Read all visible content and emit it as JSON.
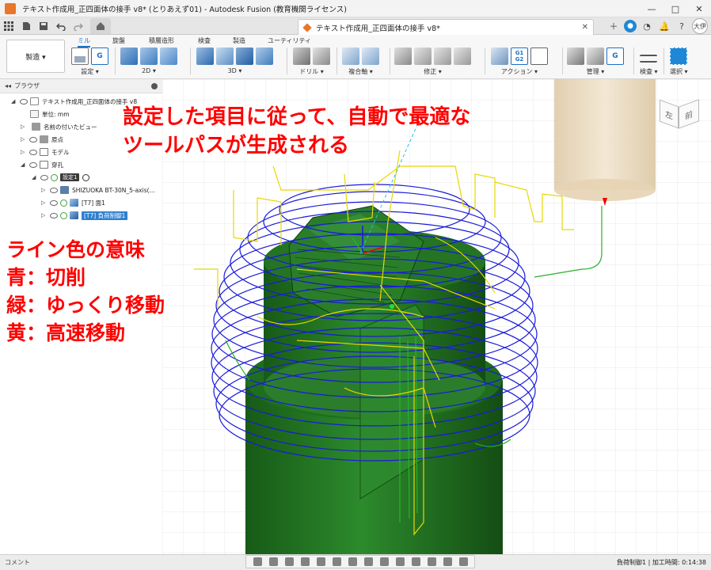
{
  "window": {
    "title": "テキスト作成用_正四面体の接手 v8* (とりあえず01) - Autodesk Fusion (教育機関ライセンス)",
    "buttons": [
      "—",
      "□",
      "✕"
    ]
  },
  "tabbar": {
    "doc_title": "テキスト作成用_正四面体の接手 v8*",
    "close": "✕",
    "avatar": "大伊"
  },
  "ribbon": {
    "workspace": "製造 ▾",
    "tabs": [
      "ミル",
      "旋盤",
      "積層造形",
      "検査",
      "製造",
      "ユーティリティ"
    ],
    "groups": [
      "設定 ▾",
      "2D ▾",
      "3D ▾",
      "ドリル ▾",
      "複合軸 ▾",
      "修正 ▾",
      "アクション ▾",
      "管理 ▾",
      "検査 ▾",
      "選択 ▾"
    ]
  },
  "browser": {
    "title": "ブラウザ",
    "items": [
      {
        "label": "テキスト作成用_正四面体の接手 v8"
      },
      {
        "label": "単位: mm"
      },
      {
        "label": "名前の付いたビュー"
      },
      {
        "label": "原点"
      },
      {
        "label": "モデル"
      },
      {
        "label": "穿孔"
      },
      {
        "label": "設定1"
      },
      {
        "label": "SHIZUOKA BT-30N_5-axis(..."
      },
      {
        "label": "[T7] 面1"
      },
      {
        "label": "[T7] 負荷制御1"
      }
    ]
  },
  "viewcube": {
    "left": "左",
    "front": "前"
  },
  "annotations": {
    "top_line1": "設定した項目に従って、自動で最適な",
    "top_line2": "ツールパスが生成される",
    "legend_title": "ライン色の意味",
    "legend_blue": "青：切削",
    "legend_green": "緑：ゆっくり移動",
    "legend_yellow": "黄：高速移動"
  },
  "statusbar": {
    "comment_label": "コメント",
    "status": "負荷制御1 | 加工時間: 0:14:38"
  },
  "colors": {
    "cutting": "#1a1adc",
    "slow_move": "#28b028",
    "rapid_move": "#f0e000",
    "stock": "#e9d9bd",
    "part": "#1f6b1f",
    "accent": "#1e6fc3",
    "annotation": "#ff0000"
  }
}
